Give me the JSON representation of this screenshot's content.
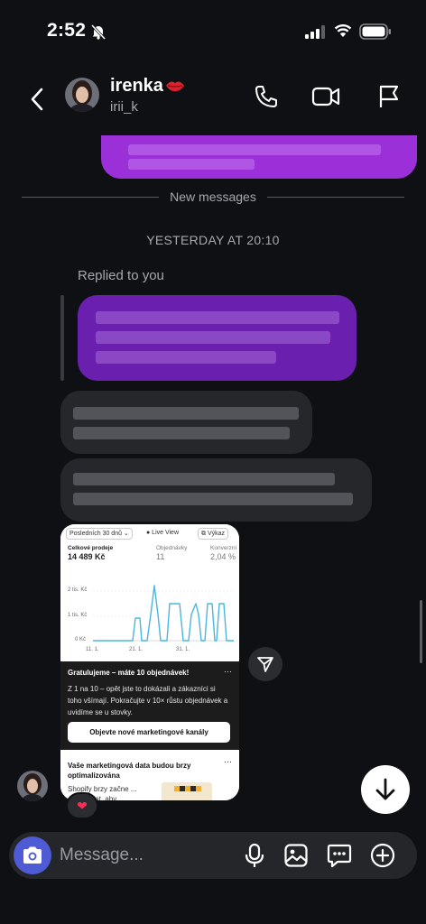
{
  "status_bar": {
    "time": "2:52"
  },
  "header": {
    "name": "irenka",
    "handle": "irii_k"
  },
  "thread": {
    "new_messages": "New messages",
    "date_separator": "YESTERDAY AT 20:10",
    "replied_label": "Replied to you"
  },
  "shared_screenshot": {
    "chip_period": "Posledních 30 dnů ⌄",
    "chip_live": "● Live View",
    "chip_report": "⧉ Výkaz",
    "metric1_label": "Celkové prodeje",
    "metric1_value": "14 489 Kč",
    "metric2_label": "Objednávky",
    "metric2_value": "11",
    "metric3_label": "Konverzní",
    "metric3_value": "2,04 %",
    "y_ticks": [
      "2 tis. Kč",
      "1 tis. Kč",
      "0 Kč"
    ],
    "x_ticks": [
      "11. 1.",
      "21. 1.",
      "31. 1."
    ],
    "card1_title": "Gratulujeme – máte 10 objednávek!",
    "card1_body": "Z 1 na 10 – opět jste to dokázali a zákazníci si toho všímají. Pokračujte v 10× růstu objednávek a uvidíme se u stovky.",
    "card1_cta": "Objevte nové marketingové kanály",
    "card2_title": "Vaše marketingová data budou brzy optimalizována",
    "card2_body": "Shopify brzy začne ... sdílení dat, aby",
    "more_dots": "···"
  },
  "composer": {
    "placeholder": "Message..."
  },
  "reaction": "❤",
  "colors": {
    "background": "#0f1014",
    "purple_bubble": "#6a1fae",
    "gray_bubble": "#26272b",
    "camera_button": "#4f5bd5"
  }
}
